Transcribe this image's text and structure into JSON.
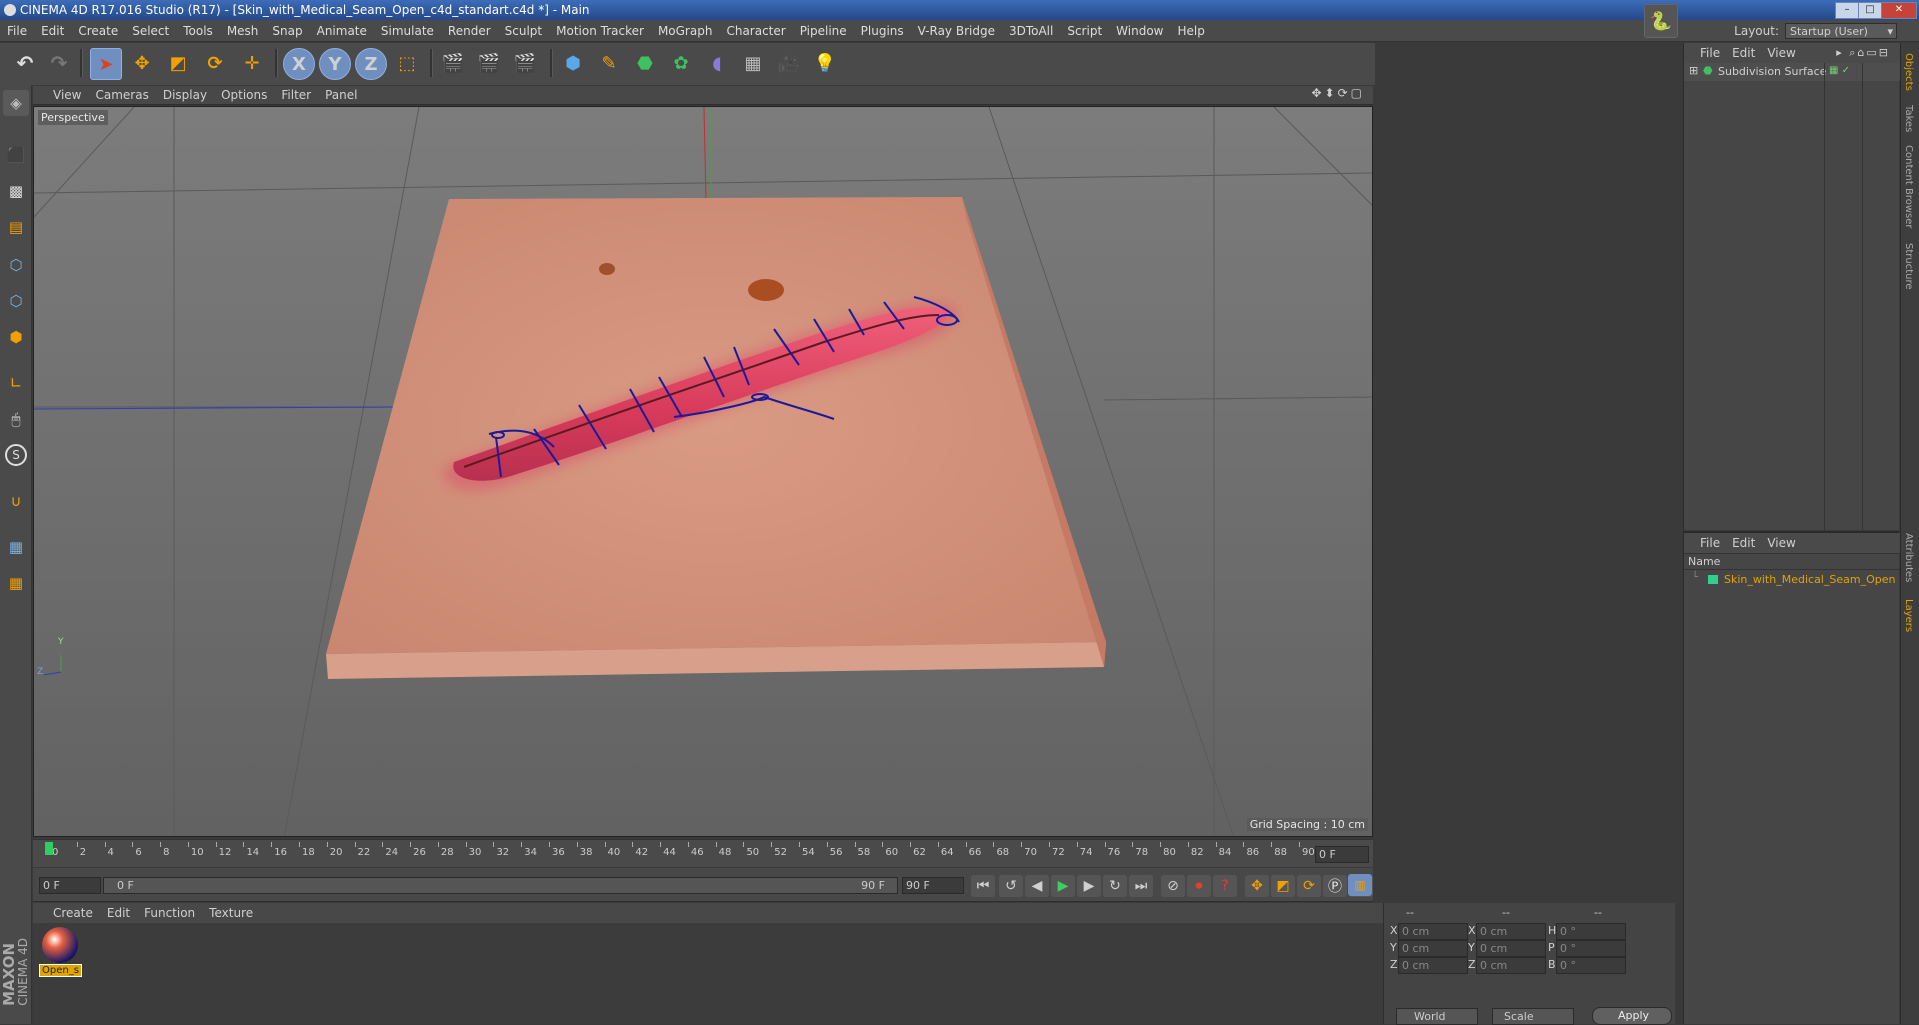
{
  "window": {
    "title": "CINEMA 4D R17.016 Studio (R17) - [Skin_with_Medical_Seam_Open_c4d_standart.c4d *] - Main",
    "controls": [
      "–",
      "□",
      "✕"
    ]
  },
  "menubar": {
    "items": [
      "File",
      "Edit",
      "Create",
      "Select",
      "Tools",
      "Mesh",
      "Snap",
      "Animate",
      "Simulate",
      "Render",
      "Sculpt",
      "Motion Tracker",
      "MoGraph",
      "Character",
      "Pipeline",
      "Plugins",
      "V-Ray Bridge",
      "3DToAll",
      "Script",
      "Window",
      "Help"
    ],
    "layout_label": "Layout:",
    "layout_value": "Startup (User)"
  },
  "toolbar": {
    "axis_x": "X",
    "axis_y": "Y",
    "axis_z": "Z"
  },
  "viewport": {
    "menu": [
      "View",
      "Cameras",
      "Display",
      "Options",
      "Filter",
      "Panel"
    ],
    "label": "Perspective",
    "grid_spacing": "Grid Spacing : 10 cm",
    "axis_y": "Y",
    "axis_z": "Z"
  },
  "timeline": {
    "ticks": [
      "0",
      "2",
      "4",
      "6",
      "8",
      "10",
      "12",
      "14",
      "16",
      "18",
      "20",
      "22",
      "24",
      "26",
      "28",
      "30",
      "32",
      "34",
      "36",
      "38",
      "40",
      "42",
      "44",
      "46",
      "48",
      "50",
      "52",
      "54",
      "56",
      "58",
      "60",
      "62",
      "64",
      "66",
      "68",
      "70",
      "72",
      "74",
      "76",
      "78",
      "80",
      "82",
      "84",
      "86",
      "88",
      "90"
    ],
    "current_frame": "0 F",
    "start_field": "0 F",
    "range_start": "0 F",
    "range_end": "90 F",
    "end_field": "90 F",
    "playhead_fraction": 0
  },
  "material_manager": {
    "menu": [
      "Create",
      "Edit",
      "Function",
      "Texture"
    ],
    "material_name": "Open_s"
  },
  "coordinates": {
    "header": [
      "--",
      "--",
      "--"
    ],
    "rows": [
      {
        "a": "X",
        "av": "0 cm",
        "b": "X",
        "bv": "0 cm",
        "c": "H",
        "cv": "0 °"
      },
      {
        "a": "Y",
        "av": "0 cm",
        "b": "Y",
        "bv": "0 cm",
        "c": "P",
        "cv": "0 °"
      },
      {
        "a": "Z",
        "av": "0 cm",
        "b": "Z",
        "bv": "0 cm",
        "c": "B",
        "cv": "0 °"
      }
    ],
    "mode": "World",
    "scale": "Scale",
    "apply": "Apply"
  },
  "object_manager": {
    "menu": [
      "File",
      "Edit",
      "View"
    ],
    "objects": [
      {
        "name": "Subdivision Surface"
      }
    ]
  },
  "layer_manager": {
    "menu": [
      "File",
      "Edit",
      "View"
    ],
    "column_name": "Name",
    "layers": [
      {
        "name": "Skin_with_Medical_Seam_Open",
        "color": "#2fcf8f"
      }
    ]
  },
  "side_tabs": [
    "Objects",
    "Takes",
    "Content Browser",
    "Structure",
    "Attributes",
    "Layers"
  ],
  "brand": {
    "maxon": "MAXON",
    "cinema": "CINEMA 4D"
  },
  "colors": {
    "accent": "#e0a400",
    "selected_blue": "#6e8fbf",
    "playhead": "#2fcf5f"
  }
}
